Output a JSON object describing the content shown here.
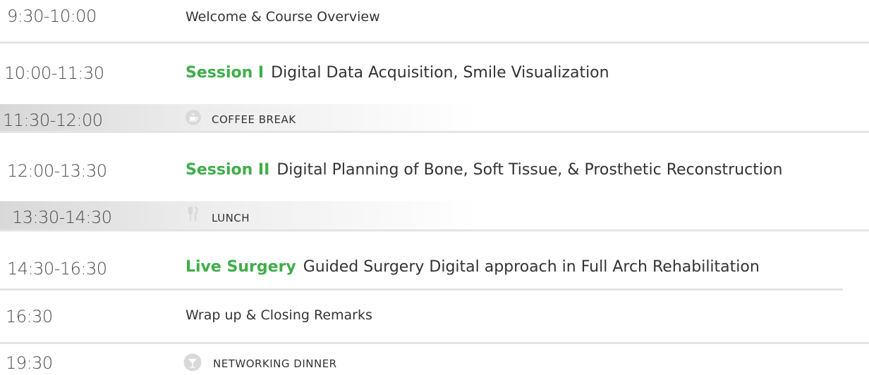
{
  "schedule": [
    {
      "time": "9:30-10:00",
      "title": "Welcome & Course Overview"
    },
    {
      "time": "10:00-11:30",
      "tag": "Session I",
      "title": "Digital Data Acquisition, Smile Visualization"
    },
    {
      "time": "11:30-12:00",
      "icon": "coffee-cup-icon",
      "title": "COFFEE BREAK"
    },
    {
      "time": "12:00-13:30",
      "tag": "Session II",
      "title": "Digital Planning of Bone, Soft Tissue, & Prosthetic Reconstruction"
    },
    {
      "time": "13:30-14:30",
      "icon": "fork-knife-icon",
      "title": "LUNCH"
    },
    {
      "time": "14:30-16:30",
      "tag": "Live Surgery",
      "title": "Guided Surgery Digital approach in Full Arch Rehabilitation"
    },
    {
      "time": "16:30",
      "title": "Wrap up & Closing Remarks"
    },
    {
      "time": "19:30",
      "icon": "cocktail-glass-icon",
      "title": "NETWORKING DINNER"
    }
  ],
  "colors": {
    "session_tag": "#3fae49",
    "time_text": "#4d4d4d",
    "title_text": "#333333",
    "divider": "#e4e4e4",
    "icon": "#d9d9d9"
  }
}
